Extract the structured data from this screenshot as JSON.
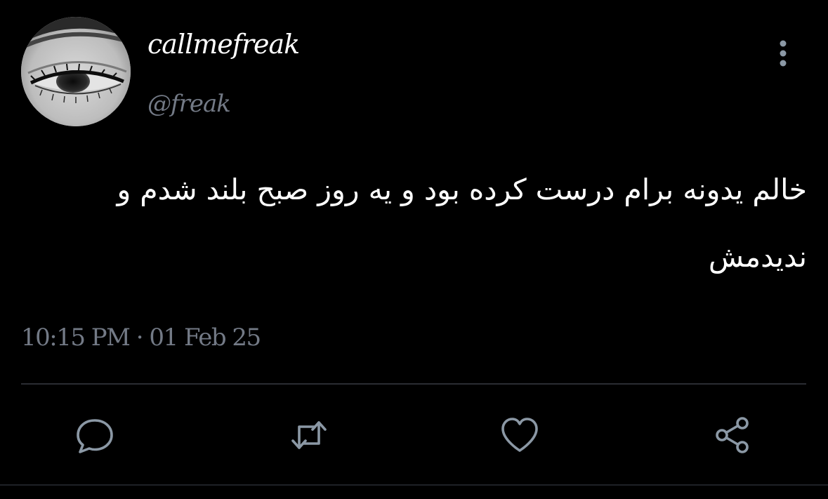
{
  "user": {
    "display_name": "callmefreak",
    "handle": "@freak",
    "avatar_icon": "eye-photo"
  },
  "tweet": {
    "text": "خالم یدونه برام درست کرده بود و یه روز صبح بلند شدم و ندیدمش",
    "timestamp": "10:15 PM · 01 Feb 25"
  },
  "actions": {
    "more_icon": "more-vertical-icon",
    "reply_icon": "reply-icon",
    "retweet_icon": "retweet-icon",
    "like_icon": "heart-icon",
    "share_icon": "share-icon"
  },
  "colors": {
    "background": "#000000",
    "primary_text": "#ffffff",
    "secondary_text": "#737a86",
    "icon": "#8b98a5"
  }
}
